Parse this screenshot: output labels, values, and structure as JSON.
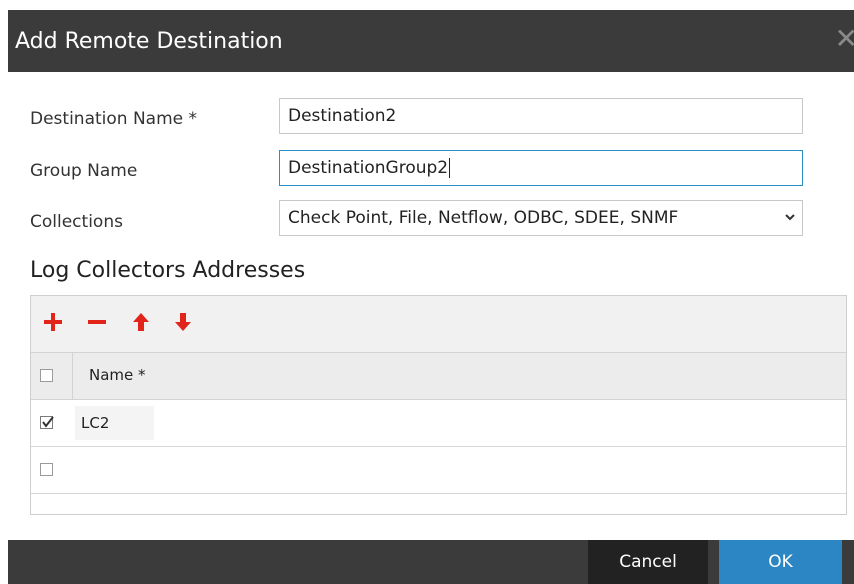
{
  "dialog": {
    "title": "Add Remote Destination",
    "close_glyph": "✕",
    "close_icon": "close-icon"
  },
  "form": {
    "destination_name": {
      "label": "Destination Name *",
      "value": "Destination2"
    },
    "group_name": {
      "label": "Group Name",
      "value": "DestinationGroup2"
    },
    "collections": {
      "label": "Collections",
      "value": "Check Point, File, Netflow, ODBC, SDEE, SNMF"
    }
  },
  "log_collectors": {
    "heading": "Log Collectors Addresses",
    "toolbar": {
      "add_icon": "plus-icon",
      "remove_icon": "minus-icon",
      "move_up_icon": "arrow-up-icon",
      "move_down_icon": "arrow-down-icon",
      "icon_color": "#e1251b"
    },
    "table": {
      "column_name": "Name *",
      "rows": [
        {
          "checked": true,
          "name": "LC2"
        },
        {
          "checked": false,
          "name": ""
        }
      ]
    }
  },
  "buttons": {
    "cancel": "Cancel",
    "ok": "OK"
  },
  "colors": {
    "titlebar": "#3b3b3b",
    "accent": "#2c86c4",
    "focus_border": "#2a8fc7"
  }
}
